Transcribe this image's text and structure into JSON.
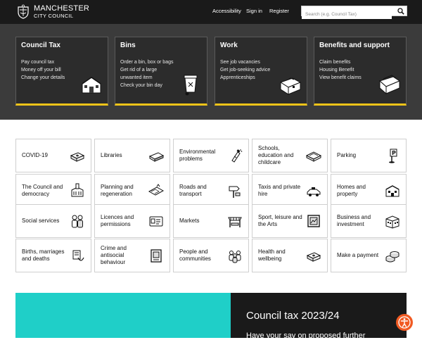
{
  "header": {
    "logo_line1": "MANCHESTER",
    "logo_line2": "CITY COUNCIL",
    "nav": [
      "Accessibility",
      "Sign in",
      "Register"
    ],
    "search_placeholder": "Search (e.g. Council Tax)"
  },
  "colors": {
    "header_bg": "#1a1a1a",
    "band_bg": "#3b3b3b",
    "accent_yellow": "#f0c419",
    "promo_teal": "#1fcfc8",
    "a11y_orange": "#f15a22"
  },
  "cards": [
    {
      "title": "Council Tax",
      "links": [
        "Pay council tax",
        "Money off your bill",
        "Change your details"
      ],
      "icon": "house-icon"
    },
    {
      "title": "Bins",
      "links": [
        "Order a bin, box or bags",
        "Get rid of a large unwanted item",
        "Check your bin day"
      ],
      "icon": "wheelie-bin-icon"
    },
    {
      "title": "Work",
      "links": [
        "See job vacancies",
        "Get job-seeking advice",
        "Apprenticeships"
      ],
      "icon": "briefcase-icon"
    },
    {
      "title": "Benefits and support",
      "links": [
        "Claim benefits",
        "Housing Benefit",
        "View benefit claims"
      ],
      "icon": "wallet-icon"
    }
  ],
  "tiles": [
    {
      "label": "COVID-19",
      "icon": "medical-kit-icon"
    },
    {
      "label": "Libraries",
      "icon": "book-icon"
    },
    {
      "label": "Environmental problems",
      "icon": "spray-can-icon"
    },
    {
      "label": "Schools, education and childcare",
      "icon": "school-book-icon"
    },
    {
      "label": "Parking",
      "icon": "parking-sign-icon"
    },
    {
      "label": "The Council and democracy",
      "icon": "town-hall-icon"
    },
    {
      "label": "Planning and regeneration",
      "icon": "map-icon"
    },
    {
      "label": "Roads and transport",
      "icon": "road-sign-icon"
    },
    {
      "label": "Taxis and private hire",
      "icon": "taxi-icon"
    },
    {
      "label": "Homes and property",
      "icon": "homes-icon"
    },
    {
      "label": "Social services",
      "icon": "people-icon"
    },
    {
      "label": "Licences and permissions",
      "icon": "licence-card-icon"
    },
    {
      "label": "Markets",
      "icon": "market-stall-icon"
    },
    {
      "label": "Sport, leisure and the Arts",
      "icon": "picture-frame-icon"
    },
    {
      "label": "Business and investment",
      "icon": "business-building-icon"
    },
    {
      "label": "Births, marriages and deaths",
      "icon": "ring-icon"
    },
    {
      "label": "Crime and antisocial behaviour",
      "icon": "notice-icon"
    },
    {
      "label": "People and communities",
      "icon": "community-icon"
    },
    {
      "label": "Health and wellbeing",
      "icon": "health-kit-icon"
    },
    {
      "label": "Make a payment",
      "icon": "coins-icon"
    }
  ],
  "promo": {
    "title": "Council tax 2023/24",
    "subtitle": "Have your say on proposed further"
  },
  "accessibility_button": {
    "icon": "accessibility-icon"
  }
}
